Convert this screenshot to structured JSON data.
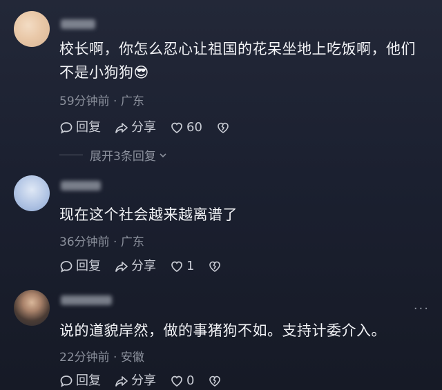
{
  "comments": [
    {
      "text": "校长啊，你怎么忍心让祖国的花呆坐地上吃饭啊，他们不是小狗狗😎",
      "time": "59分钟前",
      "location": "广东",
      "reply_label": "回复",
      "share_label": "分享",
      "likes": "60",
      "replies_label": "展开3条回复"
    },
    {
      "text": "现在这个社会越来越离谱了",
      "time": "36分钟前",
      "location": "广东",
      "reply_label": "回复",
      "share_label": "分享",
      "likes": "1"
    },
    {
      "text": "说的道貌岸然，做的事猪狗不如。支持计委介入。",
      "time": "22分钟前",
      "location": "安徽",
      "reply_label": "回复",
      "share_label": "分享",
      "likes": "0",
      "more_label": "···"
    }
  ],
  "separator": "·",
  "icons": {
    "reply": "reply-bubble-icon",
    "share": "share-arrow-icon",
    "like": "heart-icon",
    "dislike": "broken-heart-icon",
    "expand": "chevron-down-icon"
  }
}
